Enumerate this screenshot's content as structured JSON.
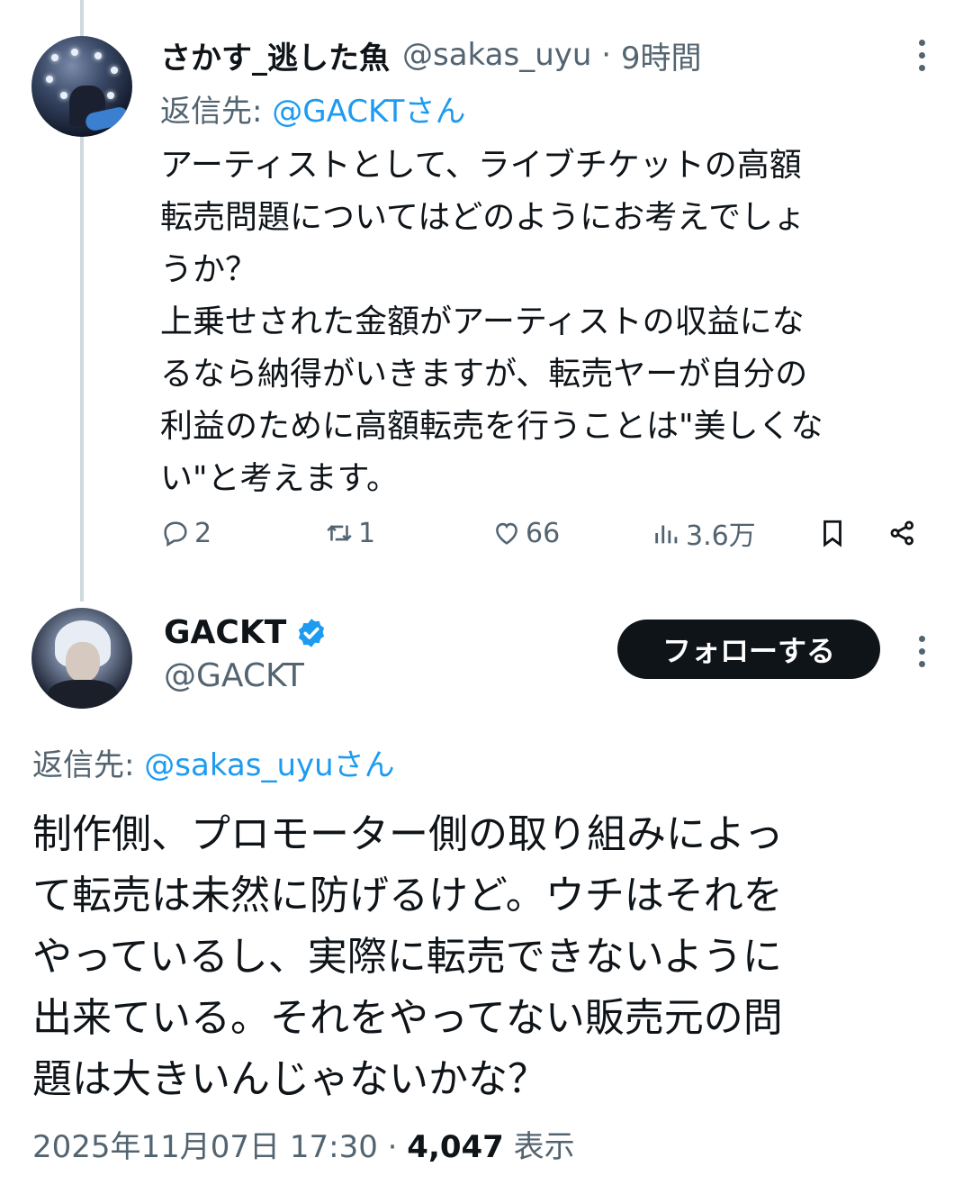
{
  "reply_tweet": {
    "display_name": "さかす_逃した魚",
    "handle": "@sakas_uyu",
    "separator": "·",
    "time": "9時間",
    "reply_to_label": "返信先: ",
    "reply_to_mention": "@GACKTさん",
    "body": "アーティストとして、ライブチケットの高額\n転売問題についてはどのようにお考えでしょ\nうか？\n上乗せされた金額がアーティストの収益にな\nるなら納得がいきますが、転売ヤーが自分の\n利益のために高額転売を行うことは\"美しくな\nい\"と考えます。",
    "actions": {
      "reply_count": "2",
      "retweet_count": "1",
      "like_count": "66",
      "view_count": "3.6万"
    },
    "icons": [
      "reply-icon",
      "retweet-icon",
      "like-icon",
      "views-icon",
      "bookmark-icon",
      "share-icon",
      "more-icon"
    ]
  },
  "main_tweet": {
    "display_name": "GACKT",
    "verified": true,
    "handle": "@GACKT",
    "follow_label": "フォローする",
    "reply_to_label": "返信先: ",
    "reply_to_mention": "@sakas_uyuさん",
    "body": "制作側、プロモーター側の取り組みによっ\nて転売は未然に防げるけど。ウチはそれを\nやっているし、実際に転売できないように\n出来ている。それをやってない販売元の問\n題は大きいんじゃないかな？",
    "timestamp": "2025年11月07日 17:30",
    "separator": " · ",
    "views": "4,047",
    "views_label": " 表示"
  },
  "colors": {
    "text": "#0f1419",
    "secondary": "#536471",
    "link": "#1d9bf0",
    "thread_line": "#cfd9de",
    "follow_bg": "#0f1419"
  }
}
